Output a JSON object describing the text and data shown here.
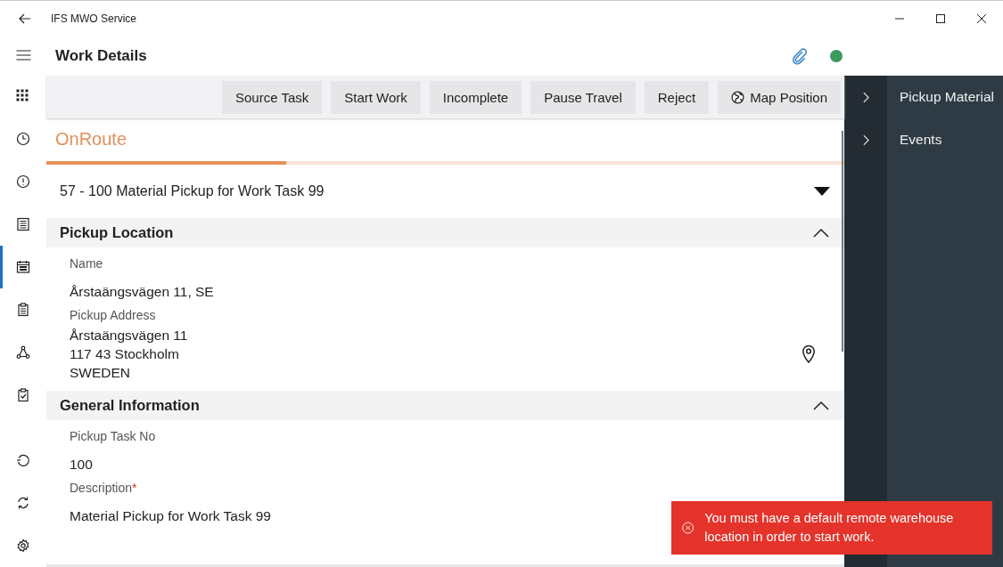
{
  "window": {
    "title": "IFS MWO Service"
  },
  "header": {
    "title": "Work Details",
    "online": true
  },
  "nav": [
    {
      "kind": "grid",
      "selected": false
    },
    {
      "kind": "clock",
      "selected": false
    },
    {
      "kind": "alert",
      "selected": false
    },
    {
      "kind": "list",
      "selected": false
    },
    {
      "kind": "calendar",
      "selected": true
    },
    {
      "kind": "clipboard",
      "selected": false
    },
    {
      "kind": "network",
      "selected": false
    },
    {
      "kind": "checklist",
      "selected": false
    }
  ],
  "nav_bottom": [
    {
      "kind": "history",
      "selected": false
    },
    {
      "kind": "sync",
      "selected": false
    },
    {
      "kind": "settings",
      "selected": false
    }
  ],
  "toolbar": [
    {
      "label": "Source Task"
    },
    {
      "label": "Start Work"
    },
    {
      "label": "Incomplete"
    },
    {
      "label": "Pause Travel"
    },
    {
      "label": "Reject"
    },
    {
      "label": "Map Position",
      "kind": "with_icon"
    }
  ],
  "status": {
    "label": "OnRoute",
    "level": 0.3
  },
  "work_task": {
    "value": "57 - 100 Material Pickup for Work Task 99"
  },
  "sections": [
    {
      "title": "Pickup Location",
      "expanded": true,
      "fields": [
        {
          "label": "Name",
          "value": "Årstaängsvägen 11, SE"
        },
        {
          "label": "Pickup Address",
          "lines": [
            "Årstaängsvägen 11",
            "117 43 Stockholm",
            "SWEDEN"
          ],
          "map_pin": true
        }
      ]
    },
    {
      "title": "General Information",
      "expanded": true,
      "fields": [
        {
          "label": "Pickup Task No",
          "value": "100"
        },
        {
          "label": "Description",
          "required_mark": "*",
          "value": "Material Pickup for Work Task 99"
        }
      ]
    }
  ],
  "side_panel": {
    "items": [
      {
        "label": "Pickup Material"
      },
      {
        "label": "Events"
      }
    ]
  },
  "toast": {
    "kind": "error",
    "message": "You must have a default remote warehouse location in order to start work."
  }
}
